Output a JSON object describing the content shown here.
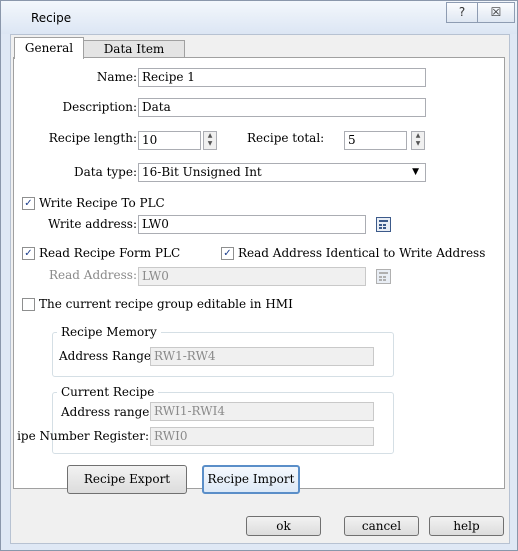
{
  "window": {
    "title": "Recipe",
    "help_glyph": "?",
    "close_glyph": "☒"
  },
  "tabs": [
    {
      "label": "General"
    },
    {
      "label": "Data Item"
    }
  ],
  "form": {
    "name_label": "Name:",
    "name_value": "Recipe 1",
    "description_label": "Description:",
    "description_value": "Data",
    "recipe_length_label": "Recipe length:",
    "recipe_length_value": "10",
    "recipe_total_label": "Recipe total:",
    "recipe_total_value": "5",
    "data_type_label": "Data type:",
    "data_type_value": "16-Bit Unsigned Int",
    "write_recipe_label": "Write Recipe To PLC",
    "write_recipe_checked": true,
    "write_address_label": "Write address:",
    "write_address_value": "LW0",
    "read_recipe_label": "Read Recipe Form PLC",
    "read_recipe_checked": true,
    "read_identical_label": "Read Address Identical to Write Address",
    "read_identical_checked": true,
    "read_address_label": "Read Address:",
    "read_address_value": "LW0",
    "editable_label": "The current recipe group editable in HMI",
    "editable_checked": false
  },
  "recipe_memory": {
    "legend": "Recipe Memory",
    "address_range_label": "Address Range:",
    "address_range_value": "RW1-RW4"
  },
  "current_recipe": {
    "legend": "Current Recipe",
    "address_range_label": "Address range:",
    "address_range_value": "RWI1-RWI4",
    "number_register_label": "ipe Number Register:",
    "number_register_value": "RWI0"
  },
  "buttons": {
    "export": "Recipe Export",
    "import": "Recipe Import",
    "ok": "ok",
    "cancel": "cancel",
    "help": "help"
  }
}
